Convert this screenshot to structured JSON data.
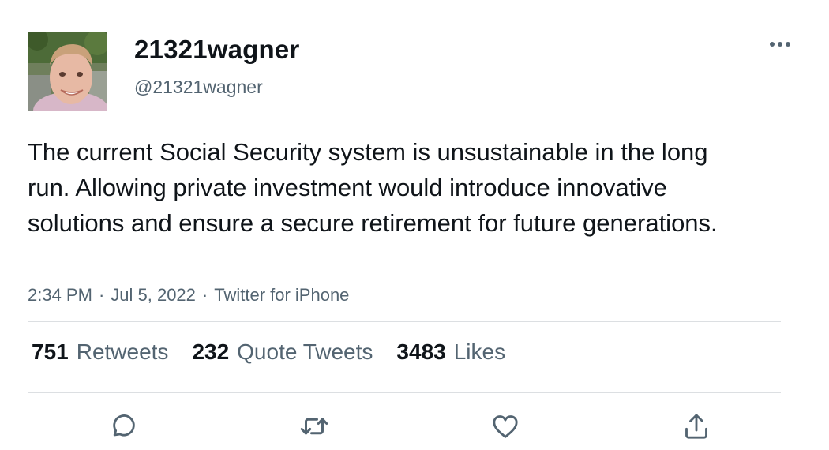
{
  "tweet": {
    "display_name": "21321wagner",
    "handle": "@21321wagner",
    "text": "The current Social Security system is unsustainable in the long run. Allowing private investment would introduce innovative solutions and ensure a secure retirement for future generations.",
    "time": "2:34 PM",
    "separator": "·",
    "date": "Jul 5, 2022",
    "source": "Twitter for iPhone"
  },
  "stats": {
    "retweets_count": "751",
    "retweets_label": "Retweets",
    "quotes_count": "232",
    "quotes_label": "Quote Tweets",
    "likes_count": "3483",
    "likes_label": "Likes"
  },
  "icons": {
    "more": "more-horizontal-icon",
    "reply": "reply-bubble-icon",
    "retweet": "retweet-arrows-icon",
    "like": "heart-icon",
    "share": "share-upload-icon"
  },
  "colors": {
    "text_primary": "#0f1419",
    "text_secondary": "#536471",
    "divider": "#dcdfe2"
  }
}
